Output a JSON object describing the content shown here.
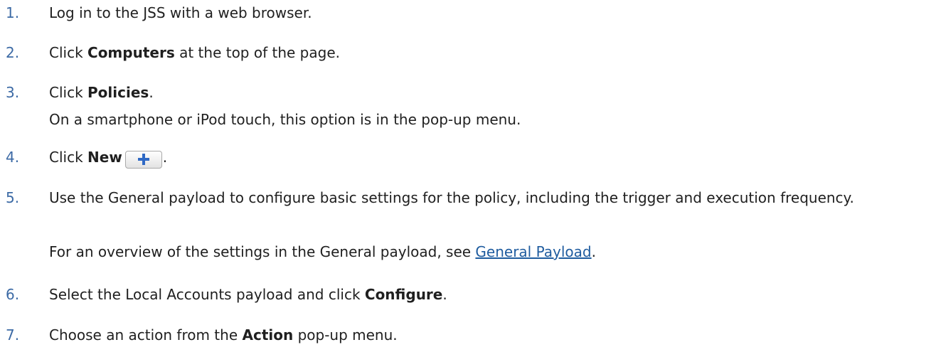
{
  "steps": [
    {
      "num": "1.",
      "text": "Log in to the JSS with a web browser."
    },
    {
      "num": "2.",
      "pre": "Click ",
      "bold": "Computers",
      "post": " at the top of the page."
    },
    {
      "num": "3.",
      "pre": "Click ",
      "bold": "Policies",
      "post": ".",
      "note": "On a smartphone or iPod touch, this option is in the pop-up menu."
    },
    {
      "num": "4.",
      "pre": "Click ",
      "bold": "New",
      "post": ".",
      "button_icon": "plus-icon"
    },
    {
      "num": "5.",
      "text": "Use the General payload to configure basic settings for the policy, including the trigger and execution frequency.",
      "note_pre": "For an overview of the settings in the General payload, see ",
      "note_link": "General Payload",
      "note_post": "."
    },
    {
      "num": "6.",
      "pre": "Select the Local Accounts payload and click ",
      "bold": "Configure",
      "post": "."
    },
    {
      "num": "7.",
      "pre": "Choose an action from the ",
      "bold": "Action",
      "post": " pop-up menu."
    }
  ],
  "colors": {
    "step_number": "#3c6aa5",
    "link": "#1f5c9f",
    "body_text": "#1f1f1f",
    "plus_icon": "#2f69c5"
  }
}
